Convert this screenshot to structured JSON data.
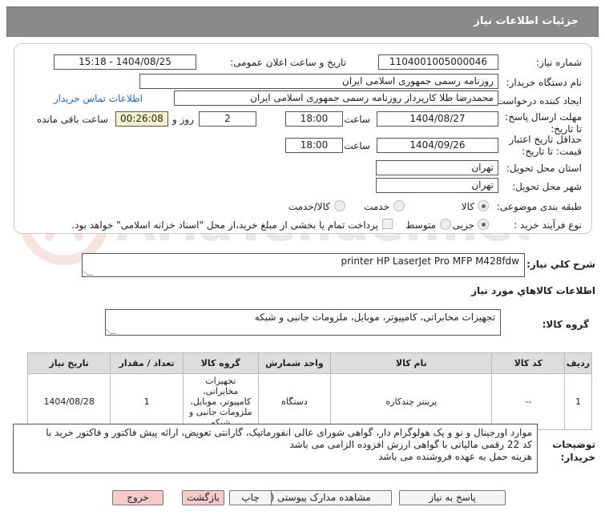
{
  "header": {
    "title": "جزئیات اطلاعات نیاز"
  },
  "fields": {
    "need_number_label": "شماره نیاز:",
    "need_number": "1104001005000046",
    "announce_label": "تاریخ و ساعت اعلان عمومی:",
    "announce_value": "1404/08/25 - 15:18",
    "buyer_label": "نام دستگاه خریدار:",
    "buyer_value": "روزنامه رسمی جمهوری اسلامی ایران",
    "creator_label": "ایجاد کننده درخواست:",
    "creator_value": "محمدرضا طلا کارپرداز روزنامه رسمی جمهوری اسلامی ایران",
    "contact_link": "اطلاعات تماس خریدار",
    "deadline_label": "مهلت ارسال پاسخ: تا تاریخ:",
    "deadline_date": "1404/08/27",
    "time_label": "ساعت",
    "deadline_time": "18:00",
    "days_value": "2",
    "days_label": "روز و",
    "remaining_value": "00:26:08",
    "remaining_label": "ساعت باقی مانده",
    "validity_label": "حداقل تاریخ اعتبار قیمت: تا تاریخ:",
    "validity_date": "1404/09/26",
    "validity_time": "18:00",
    "province_label": "استان محل تحویل:",
    "province_value": "تهران",
    "city_label": "شهر محل تحویل:",
    "city_value": "تهران",
    "category_label": "طبقه بندی موضوعی:",
    "cat_goods": "کالا",
    "cat_service": "خدمت",
    "cat_goods_service": "کالا/خدمت",
    "process_label": "نوع فرآیند خرید :",
    "proc_minor": "جزیی",
    "proc_medium": "متوسط",
    "payment_note": "پرداخت تمام یا بخشی از مبلغ خرید،از محل \"اسناد خزانه اسلامی\" خواهد بود."
  },
  "general": {
    "desc_label": "شرح کلي نياز:",
    "desc_value": "printer HP LaserJet Pro MFP M428fdw",
    "goods_info_title": "اطلاعات کالاهاي مورد نياز",
    "group_label": "گروه کالا:",
    "group_value": "تجهیزات مخابراتی، کامپیوتر، موبایل، ملزومات جانبی و شبکه"
  },
  "table": {
    "headers": [
      "ردیف",
      "کد کالا",
      "نام کالا",
      "واحد شمارش",
      "گروه کالا",
      "تعداد / مقدار",
      "تاریخ نیاز"
    ],
    "rows": [
      {
        "row": "1",
        "code": "--",
        "name": "پرینتر چندکاره",
        "unit": "دستگاه",
        "group": "تجهیزات مخابراتی، کامپیوتر، موبایل، ملزومات جانبی و شبکه",
        "qty": "1",
        "date": "1404/08/28"
      }
    ]
  },
  "notes": {
    "label": "توضیحات خریدار:",
    "line1": "موارد اورجینال  و نو و پک هولوگرام دار، گواهی شورای عالی انفورماتیک، گارانتی تعویض، ارائه پیش فاکتور و فاکتور خرید با",
    "line2": "کد 22 رقمی مالیاتی با گواهی ارزش افزوده  الزامی می باشد",
    "line3": "هزینه حمل به عهده فروشنده می باشد"
  },
  "buttons": {
    "reply": "پاسخ به نیاز",
    "docs": "مشاهده مدارک پیوستی (0)",
    "print": "چاپ",
    "back": "بازگشت",
    "exit": "خروج"
  },
  "watermark": {
    "text": "AriaTender.net"
  },
  "colors": {
    "header_bg": "#8a8a8a",
    "link": "#1e66c8",
    "remaining_bg": "#f7f0c8",
    "exit_bg": "#f7c9c9"
  }
}
